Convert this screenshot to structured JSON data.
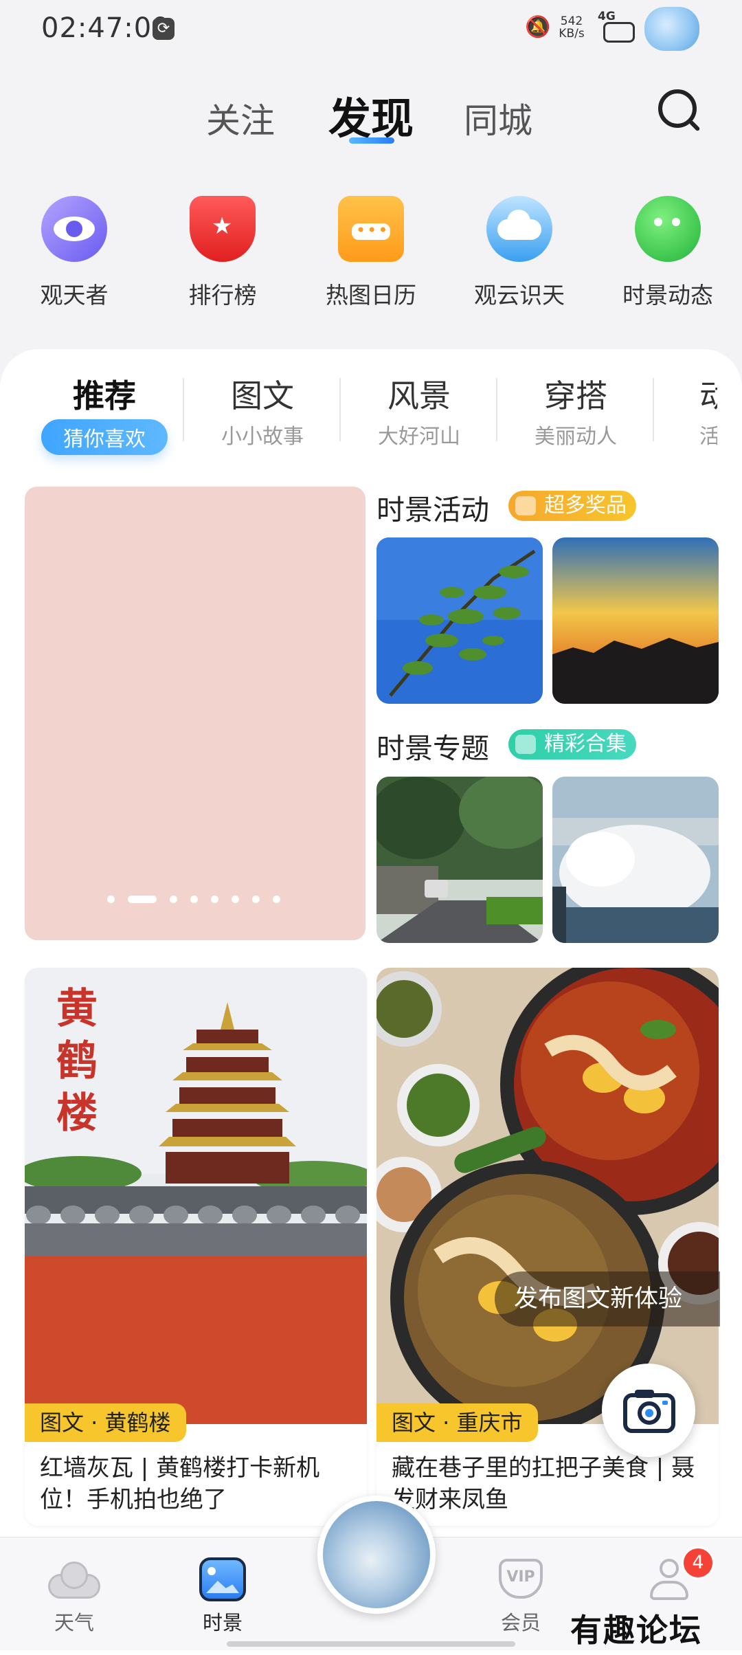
{
  "status_bar": {
    "time": "02:47:09",
    "speed_value": "542",
    "speed_unit": "KB/s",
    "network": "4G"
  },
  "top_nav": {
    "tabs": [
      "关注",
      "发现",
      "同城"
    ],
    "active_index": 1
  },
  "shortcuts": [
    {
      "label": "观天者",
      "icon": "eye-icon"
    },
    {
      "label": "排行榜",
      "icon": "trophy-icon"
    },
    {
      "label": "热图日历",
      "icon": "calendar-icon"
    },
    {
      "label": "观云识天",
      "icon": "cloud-icon"
    },
    {
      "label": "时景动态",
      "icon": "planet-icon"
    }
  ],
  "categories": [
    {
      "title": "推荐",
      "subtitle": "猜你喜欢",
      "active": true
    },
    {
      "title": "图文",
      "subtitle": "小小故事"
    },
    {
      "title": "风景",
      "subtitle": "大好河山"
    },
    {
      "title": "穿搭",
      "subtitle": "美丽动人"
    },
    {
      "title": "动",
      "subtitle": "活动"
    }
  ],
  "banner": {
    "slide_count": 8,
    "active_index": 1,
    "color": "#f2d3cd"
  },
  "activity_section": {
    "title": "时景活动",
    "badge": "超多奖品",
    "badge_color": "#f7b52c"
  },
  "topic_section": {
    "title": "时景专题",
    "badge": "精彩合集",
    "badge_color": "#33d0b0"
  },
  "feed": [
    {
      "tag": "图文 · 黄鹤楼",
      "title": "红墙灰瓦 | 黄鹤楼打卡新机位！手机拍也绝了",
      "image_text": "黄鹤楼"
    },
    {
      "tag": "图文 · 重庆市",
      "title": "藏在巷子里的扛把子美食 | 聂发财来凤鱼"
    }
  ],
  "publish_tip": "发布图文新体验",
  "bottom_nav": {
    "items": [
      {
        "label": "天气",
        "icon": "cloud-icon"
      },
      {
        "label": "时景",
        "icon": "photo-icon",
        "active": true
      },
      {
        "label": "会员",
        "icon": "vip-icon"
      },
      {
        "label": "",
        "icon": "user-icon"
      }
    ],
    "notification_count": "4"
  },
  "watermark": "有趣论坛"
}
